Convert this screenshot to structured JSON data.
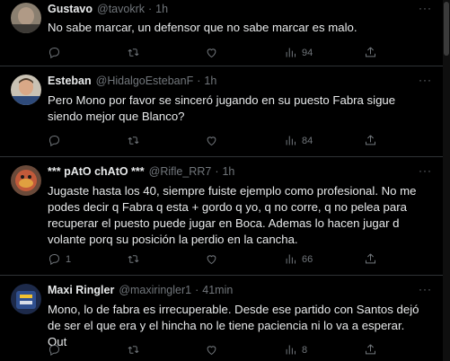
{
  "tweets": [
    {
      "name": "Gustavo",
      "handle": "@tavokrk",
      "time": "1h",
      "text": "No sabe marcar, un defensor que no sabe marcar es malo.",
      "reply_count": "",
      "views": "94"
    },
    {
      "name": "Esteban",
      "handle": "@HidalgoEstebanF",
      "time": "1h",
      "text": "Pero Mono por favor se sinceró jugando en su puesto Fabra sigue siendo mejor que Blanco?",
      "reply_count": "",
      "views": "84"
    },
    {
      "name": "*** pAtO chAtO ***",
      "handle": "@Rifle_RR7",
      "time": "1h",
      "text": "Jugaste hasta los 40, siempre fuiste ejemplo como profesional. No me podes decir q Fabra q esta + gordo q yo, q no corre, q no pelea para recuperar el puesto puede jugar en Boca. Ademas lo hacen jugar d volante porq su posición la perdio en la cancha.",
      "reply_count": "1",
      "views": "66"
    },
    {
      "name": "Maxi Ringler",
      "handle": "@maxiringler1",
      "time": "41min",
      "text": "Mono, lo de fabra es irrecuperable. Desde ese partido con Santos  dejó de ser el que era y el hincha no le tiene paciencia ni lo va a esperar. Out",
      "reply_count": "",
      "views": "8"
    }
  ],
  "separator": "·",
  "more_label": "···",
  "colors": {
    "background": "#000000",
    "text": "#e7e9ea",
    "muted": "#71767b",
    "divider": "#2f3336"
  },
  "icons": [
    "reply-icon",
    "retweet-icon",
    "like-icon",
    "views-icon",
    "share-icon"
  ]
}
